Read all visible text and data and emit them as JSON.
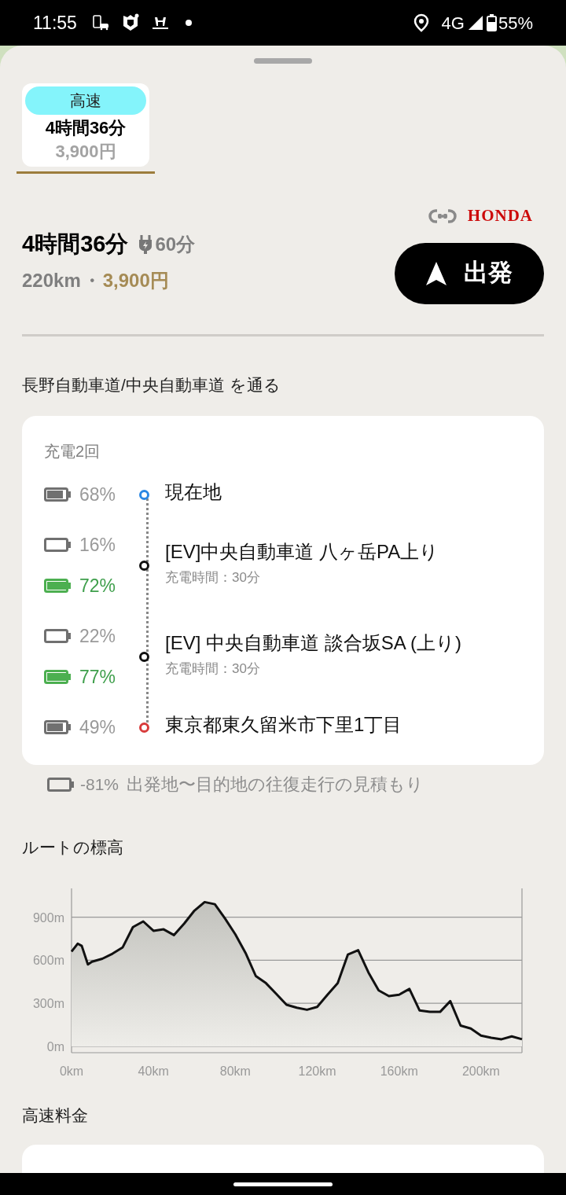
{
  "status_bar": {
    "time": "11:55",
    "network": "4G",
    "battery": "55%"
  },
  "route_tabs": [
    {
      "label": "高速",
      "duration": "4時間36分",
      "price": "3,900円",
      "selected": true
    }
  ],
  "brand": "HONDA",
  "summary": {
    "duration": "4時間36分",
    "charge_time": "60分",
    "distance": "220km",
    "separator": "・",
    "price": "3,900円"
  },
  "start_button": "出発",
  "via": "長野自動車道/中央自動車道 を通る",
  "charging": {
    "title": "充電2回",
    "stops": [
      {
        "name": "現在地",
        "color": "#2b87e3",
        "batteries": [
          {
            "reading": "68%",
            "kind": "partial"
          }
        ]
      },
      {
        "name": "[EV]中央自動車道 八ヶ岳PA上り",
        "note": "充電時間：30分",
        "color": "#111111",
        "batteries": [
          {
            "reading": "16%",
            "kind": "empty"
          },
          {
            "reading": "72%",
            "kind": "charged"
          }
        ]
      },
      {
        "name": "[EV] 中央自動車道 談合坂SA (上り)",
        "note": "充電時間：30分",
        "color": "#111111",
        "batteries": [
          {
            "reading": "22%",
            "kind": "empty"
          },
          {
            "reading": "77%",
            "kind": "charged"
          }
        ]
      },
      {
        "name": "東京都東久留米市下里1丁目",
        "color": "#d83b3b",
        "batteries": [
          {
            "reading": "49%",
            "kind": "partial"
          }
        ]
      }
    ]
  },
  "round_trip": {
    "reading": "-81%",
    "kind": "empty",
    "text": "出発地〜目的地の往復走行の見積もり"
  },
  "elevation": {
    "chart_data": {
      "type": "area",
      "title": "ルートの標高",
      "x": [
        0,
        3,
        5,
        8,
        10,
        15,
        20,
        25,
        30,
        35,
        40,
        45,
        50,
        55,
        60,
        65,
        70,
        75,
        80,
        85,
        90,
        95,
        100,
        105,
        110,
        115,
        120,
        125,
        130,
        135,
        140,
        145,
        150,
        155,
        160,
        165,
        170,
        175,
        180,
        185,
        190,
        195,
        200,
        205,
        210,
        215,
        220
      ],
      "values": [
        660,
        715,
        700,
        570,
        590,
        610,
        645,
        690,
        830,
        870,
        805,
        815,
        775,
        855,
        945,
        1005,
        990,
        890,
        780,
        650,
        490,
        440,
        365,
        290,
        270,
        255,
        275,
        360,
        440,
        640,
        670,
        515,
        390,
        350,
        360,
        400,
        250,
        240,
        240,
        315,
        145,
        125,
        75,
        60,
        50,
        70,
        50
      ],
      "xlim": [
        0,
        220
      ],
      "ylim": [
        0,
        1100
      ],
      "grid": true,
      "xticks": [
        {
          "value": 0,
          "label": "0km"
        },
        {
          "value": 40,
          "label": "40km"
        },
        {
          "value": 80,
          "label": "80km"
        },
        {
          "value": 120,
          "label": "120km"
        },
        {
          "value": 160,
          "label": "160km"
        },
        {
          "value": 200,
          "label": "200km"
        }
      ],
      "yticks": [
        {
          "value": 0,
          "label": "0m"
        },
        {
          "value": 300,
          "label": "300m"
        },
        {
          "value": 600,
          "label": "600m"
        },
        {
          "value": 900,
          "label": "900m"
        }
      ]
    }
  },
  "toll_section": {
    "title": "高速料金"
  }
}
